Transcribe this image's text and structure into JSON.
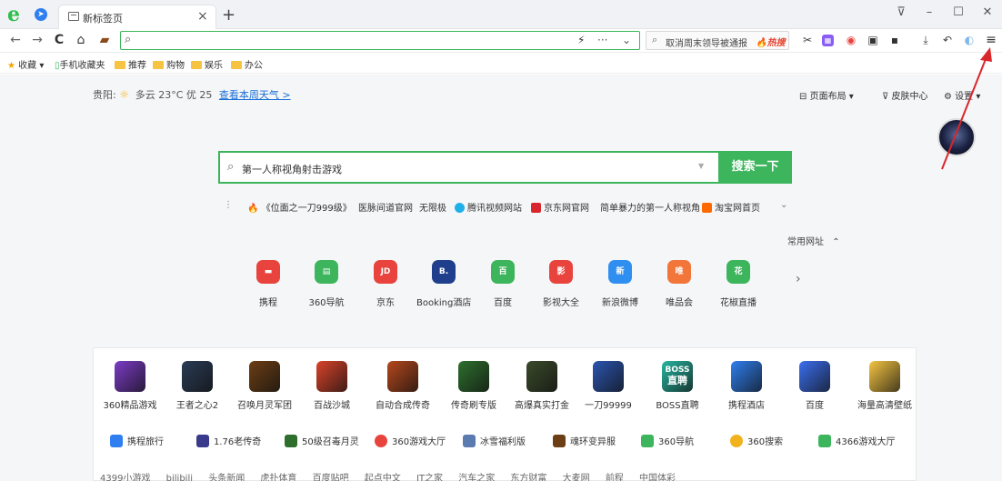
{
  "tab": {
    "title": "新标签页"
  },
  "toolbar": {
    "news_text": "取消周末领导被通报",
    "news_hot": "热搜"
  },
  "bookmarks": [
    {
      "label": "收藏",
      "icon": "star-icon"
    },
    {
      "label": "手机收藏夹",
      "icon": "phone-icon"
    },
    {
      "label": "推荐",
      "icon": "folder-icon"
    },
    {
      "label": "购物",
      "icon": "folder-icon"
    },
    {
      "label": "娱乐",
      "icon": "folder-icon"
    },
    {
      "label": "办公",
      "icon": "folder-icon"
    }
  ],
  "weather": {
    "city": "贵阳:",
    "desc": "多云 23°C  优 25",
    "link": "查看本周天气 >"
  },
  "page_options": {
    "layout": "页面布局 ▾",
    "skin": "皮肤中心",
    "settings": "设置 ▾"
  },
  "search": {
    "placeholder": "第一人称视角射击游戏",
    "button": "搜索一下"
  },
  "hotwords": [
    {
      "label": "《位面之一刀999级》",
      "color": "#e8452c"
    },
    {
      "label": "医脉间道官网",
      "color": ""
    },
    {
      "label": "无限极",
      "color": ""
    },
    {
      "label": "腾讯视频网站",
      "color": "#1fb0e8"
    },
    {
      "label": "京东网官网",
      "color": "#d9262c"
    },
    {
      "label": "简单暴力的第一人称视角",
      "color": ""
    },
    {
      "label": "淘宝网首页",
      "color": "#ff6a00"
    }
  ],
  "frequent": {
    "label": "常用网址"
  },
  "sites": [
    {
      "label": "携程",
      "glyph": "▬",
      "color": "#e8433d"
    },
    {
      "label": "360导航",
      "glyph": "▤",
      "color": "#3cb55c"
    },
    {
      "label": "京东",
      "glyph": "JD",
      "color": "#e8433d"
    },
    {
      "label": "Booking酒店",
      "glyph": "B.",
      "color": "#1f3f8c"
    },
    {
      "label": "百度",
      "glyph": "百",
      "color": "#3cb55c"
    },
    {
      "label": "影视大全",
      "glyph": "影",
      "color": "#e8433d"
    },
    {
      "label": "新浪微博",
      "glyph": "新",
      "color": "#2f8ff0"
    },
    {
      "label": "唯品会",
      "glyph": "唯",
      "color": "#f2753a"
    },
    {
      "label": "花椒直播",
      "glyph": "花",
      "color": "#3cb55c"
    }
  ],
  "games": [
    {
      "label": "360精品游戏",
      "color": "#7b3bc6"
    },
    {
      "label": "王者之心2",
      "color": "#2a3b55"
    },
    {
      "label": "召唤月灵军团",
      "color": "#6b3e14"
    },
    {
      "label": "百战沙城",
      "color": "#d9432a"
    },
    {
      "label": "自动合成传奇",
      "color": "#b5471c"
    },
    {
      "label": "传奇刷专版",
      "color": "#2e6f2e"
    },
    {
      "label": "高爆真实打金",
      "color": "#3a4a2a"
    },
    {
      "label": "一刀99999",
      "color": "#2b55b0"
    },
    {
      "label": "BOSS直聘",
      "color": "#27b5a0"
    },
    {
      "label": "携程酒店",
      "color": "#2f7ff0"
    },
    {
      "label": "百度",
      "color": "#3b6ff0"
    },
    {
      "label": "海量高清壁纸",
      "color": "#f5c542"
    }
  ],
  "boss_tile": {
    "line1": "BOSS",
    "line2": "直聘"
  },
  "links": [
    {
      "label": "携程旅行",
      "color": "#2f7ff0"
    },
    {
      "label": "1.76老传奇",
      "color": "#3a3a8c"
    },
    {
      "label": "50级召毒月灵",
      "color": "#2e6f2e"
    },
    {
      "label": "360游戏大厅",
      "color": "#e8433d"
    },
    {
      "label": "冰雪福利版",
      "color": "#5a7ab0"
    },
    {
      "label": "魂环变异服",
      "color": "#6b3e14"
    },
    {
      "label": "360导航",
      "color": "#3cb55c"
    },
    {
      "label": "360搜索",
      "color": "#f2b21d"
    },
    {
      "label": "4366游戏大厅",
      "color": "#3cb55c"
    }
  ],
  "bottom_links": [
    "4399小游戏",
    "bilibili",
    "头条新闻",
    "虎扑体育",
    "百度贴吧",
    "起点中文",
    "IT之家",
    "汽车之家",
    "东方财富",
    "大麦网",
    "前程",
    "中国体彩"
  ]
}
